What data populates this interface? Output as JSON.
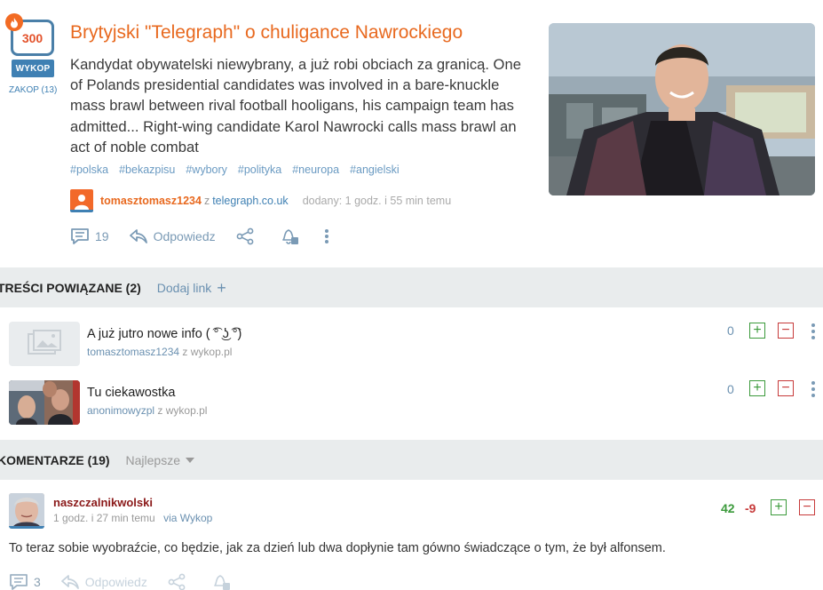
{
  "article": {
    "score": "300",
    "wykop_label": "WYKOP",
    "zakop_label": "ZAKOP (13)",
    "title": "Brytyjski \"Telegraph\" o chuligance Nawrockiego",
    "description": "Kandydat obywatelski niewybrany, a już robi obciach za granicą. One of Polands presidential candidates was involved in a bare-knuckle mass brawl between rival football hooligans, his campaign team has admitted... Right-wing candidate Karol Nawrocki calls mass brawl an act of noble combat",
    "tags": [
      "#polska",
      "#bekazpisu",
      "#wybory",
      "#polityka",
      "#neuropa",
      "#angielski"
    ],
    "author": "tomasztomasz1234",
    "source_prefix": "z",
    "source": "telegraph.co.uk",
    "added": "dodany: 1 godz. i 55 min temu",
    "comments_count": "19",
    "reply_label": "Odpowiedz"
  },
  "related": {
    "label": "TREŚCI POWIĄZANE (2)",
    "add_link_label": "Dodaj link",
    "items": [
      {
        "title": "A już jutro nowe info ( ͡° ͜ʖ ͡°)",
        "user": "tomasztomasz1234",
        "from": "z wykop.pl",
        "score": "0"
      },
      {
        "title": "Tu ciekawostka",
        "user": "anonimowyzpl",
        "from": "z wykop.pl",
        "score": "0"
      }
    ]
  },
  "comments": {
    "label": "KOMENTARZE (19)",
    "sort_label": "Najlepsze",
    "items": [
      {
        "author": "naszczalnikwolski",
        "time": "1 godz. i 27 min temu",
        "via": "via Wykop",
        "plus": "42",
        "minus": "-9",
        "body": "To teraz sobie wyobraźcie, co będzie, jak za dzień lub dwa dopłynie tam gówno świadczące o tym, że był alfonsem.",
        "replies": "3",
        "reply_label": "Odpowiedz"
      }
    ]
  },
  "colors": {
    "accent": "#e8691f",
    "link": "#3f80b3",
    "plus": "#3b9a3b",
    "minus": "#c73a3a"
  }
}
